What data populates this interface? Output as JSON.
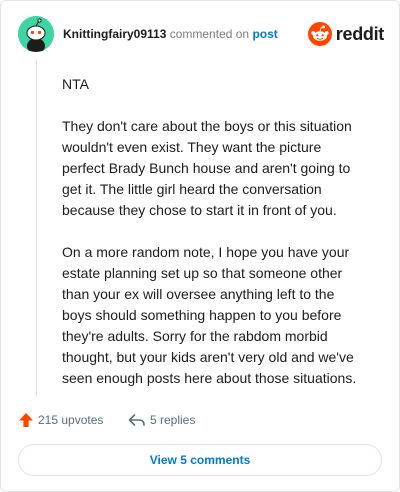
{
  "comment": {
    "username": "Knittingfairy09113",
    "verb": "commented on",
    "post_link": "post",
    "paragraphs": [
      "NTA",
      "They don't care about the boys or this situation wouldn't even exist. They want the picture perfect Brady Bunch house and aren't going to get it. The little girl heard the conversation because they chose to start it in front of you.",
      "On a more random note, I hope you have your estate planning set up so that someone other than your ex will oversee anything left to the boys should something happen to you before they're adults. Sorry for the rabdom morbid thought, but your kids aren't very old and we've seen enough posts here about those situations."
    ],
    "upvotes": "215 upvotes",
    "replies": "5 replies"
  },
  "brand": {
    "logo_text": "reddit",
    "accent": "#ff4500",
    "link_color": "#0079d3",
    "avatar_color": "#3fd4a3"
  },
  "footer": {
    "view_label": "View 5 comments"
  },
  "icons": {
    "upvote": "upvote-arrow-icon",
    "reply": "reply-arrow-icon",
    "logo": "reddit-alien-icon",
    "avatar": "snoo-avatar-icon"
  }
}
